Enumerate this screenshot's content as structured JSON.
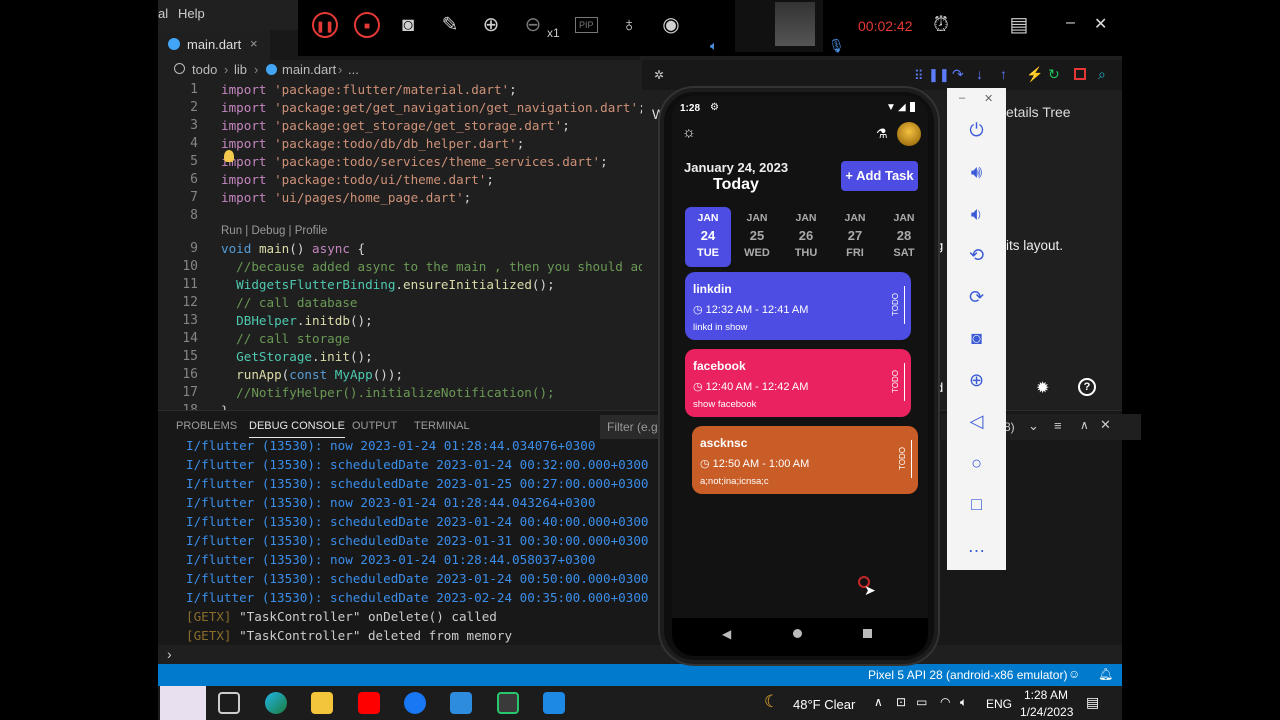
{
  "menubar": {
    "item0": "al",
    "item1": "Help"
  },
  "editor_tab": {
    "label": "main.dart",
    "close": "×"
  },
  "breadcrumb": {
    "p1": "todo",
    "p2": "lib",
    "p3": "main.dart",
    "p4": "..."
  },
  "code_lines": [
    {
      "n": "1",
      "html": "<span class='kw'>import</span> <span class='str'>'package:flutter/material.dart'</span>;"
    },
    {
      "n": "2",
      "html": "<span class='kw'>import</span> <span class='str'>'package:get/get_navigation/get_navigation.dart'</span>;"
    },
    {
      "n": "3",
      "html": "<span class='kw'>import</span> <span class='str'>'package:get_storage/get_storage.dart'</span>;"
    },
    {
      "n": "4",
      "html": "<span class='kw'>import</span> <span class='str'>'package:todo/db/db_helper.dart'</span>;"
    },
    {
      "n": "5",
      "html": "<span class='kw'>import</span> <span class='str'>'package:todo/services/theme_services.dart'</span>;"
    },
    {
      "n": "6",
      "html": "<span class='kw'>import</span> <span class='str'>'package:todo/ui/theme.dart'</span>;"
    },
    {
      "n": "7",
      "html": "<span class='kw'>import</span> <span class='str'>'ui/pages/home_page.dart'</span>;"
    },
    {
      "n": "8",
      "html": ""
    },
    {
      "n": "9",
      "html": "<span class='bl'>void</span> <span class='fn'>main</span>() <span class='kw'>async</span> {"
    },
    {
      "n": "10",
      "html": "  <span class='cm'>//because added async to the main , then you should add</span>"
    },
    {
      "n": "11",
      "html": "  <span class='cls'>WidgetsFlutterBinding</span>.<span class='fn'>ensureInitialized</span>();"
    },
    {
      "n": "12",
      "html": "  <span class='cm'>// call database</span>"
    },
    {
      "n": "13",
      "html": "  <span class='cls'>DBHelper</span>.<span class='fn'>initdb</span>();"
    },
    {
      "n": "14",
      "html": "  <span class='cm'>// call storage</span>"
    },
    {
      "n": "15",
      "html": "  <span class='cls'>GetStorage</span>.<span class='fn'>init</span>();"
    },
    {
      "n": "16",
      "html": "  <span class='fn'>runApp</span>(<span class='bl'>const</span> <span class='cls'>MyApp</span>());"
    },
    {
      "n": "17",
      "html": "  <span class='cm'>//NotifyHelper().initializeNotification();</span>"
    },
    {
      "n": "18",
      "html": "}"
    }
  ],
  "codelens": "Run | Debug | Profile",
  "panel_tabs": {
    "problems": "PROBLEMS",
    "debug": "DEBUG CONSOLE",
    "output": "OUTPUT",
    "terminal": "TERMINAL",
    "filter": "Filter (e.g."
  },
  "logs": [
    {
      "text": "I/flutter (13530): now 2023-01-24 01:28:44.034076+0300",
      "g": false
    },
    {
      "text": "I/flutter (13530): scheduledDate 2023-01-24 00:32:00.000+0300",
      "g": false
    },
    {
      "text": "I/flutter (13530): scheduledDate 2023-01-25 00:27:00.000+0300",
      "g": false
    },
    {
      "text": "I/flutter (13530): now 2023-01-24 01:28:44.043264+0300",
      "g": false
    },
    {
      "text": "I/flutter (13530): scheduledDate 2023-01-24 00:40:00.000+0300",
      "g": false
    },
    {
      "text": "I/flutter (13530): scheduledDate 2023-01-31 00:30:00.000+0300",
      "g": false
    },
    {
      "text": "I/flutter (13530): now 2023-01-24 01:28:44.058037+0300",
      "g": false
    },
    {
      "text": "I/flutter (13530): scheduledDate 2023-01-24 00:50:00.000+0300",
      "g": false
    },
    {
      "text": "I/flutter (13530): scheduledDate 2023-02-24 00:35:00.000+0300",
      "g": false
    }
  ],
  "getx_logs": [
    {
      "tag": "[GETX]",
      "msg": " \"TaskController\" onDelete() called"
    },
    {
      "tag": "[GETX]",
      "msg": " \"TaskController\" deleted from memory"
    }
  ],
  "right_pane": {
    "title_fragment": "etails Tree",
    "layout_text": "its layout.",
    "w_fragment": "W",
    "select_fragment": "8)"
  },
  "statusbar": {
    "device": "Pixel 5 API 28 (android-x86 emulator)"
  },
  "recorder": {
    "timer": "00:02:42",
    "zoom": "x1",
    "pip": "PIP"
  },
  "phone": {
    "status_time": "1:28",
    "date": "January 24, 2023",
    "today": "Today",
    "add_task": "+ Add Task",
    "days": [
      {
        "m": "JAN",
        "n": "24",
        "w": "TUE",
        "selected": true
      },
      {
        "m": "JAN",
        "n": "25",
        "w": "WED",
        "selected": false
      },
      {
        "m": "JAN",
        "n": "26",
        "w": "THU",
        "selected": false
      },
      {
        "m": "JAN",
        "n": "27",
        "w": "FRI",
        "selected": false
      },
      {
        "m": "JAN",
        "n": "28",
        "w": "SAT",
        "selected": false
      }
    ],
    "tasks": [
      {
        "title": "linkdin",
        "time": "12:32 AM - 12:41 AM",
        "desc": "linkd in show",
        "status": "TODO",
        "color": "#4e4de3"
      },
      {
        "title": "facebook",
        "time": "12:40 AM - 12:42 AM",
        "desc": "show facebook",
        "status": "TODO",
        "color": "#ea2260"
      },
      {
        "title": "ascknsc",
        "time": "12:50 AM - 1:00 AM",
        "desc": "a;not;ina;icnsa;c",
        "status": "TODO",
        "color": "#c95d28"
      }
    ]
  },
  "taskbar": {
    "weather": "48°F Clear",
    "lang": "ENG",
    "time": "1:28 AM",
    "date": "1/24/2023"
  }
}
